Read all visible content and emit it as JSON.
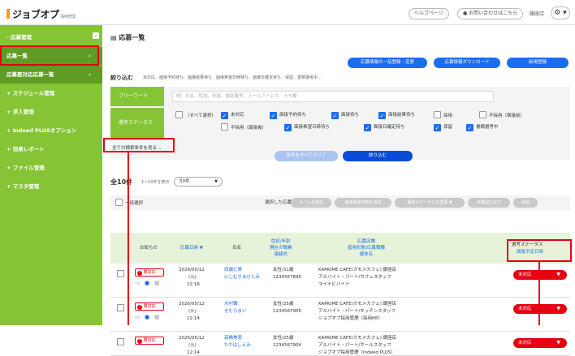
{
  "header": {
    "logo": "ジョブオプ",
    "logo_sub": "採用管理",
    "help": "ヘルプページ",
    "contact": "お問い合わせはこちら",
    "shop": "銀座店",
    "gear": "⚙ ▾"
  },
  "sidebar": {
    "items": [
      {
        "label": "応募管理",
        "prefix": "-"
      },
      {
        "label": "応募一覧",
        "prefix": "",
        "arrow": "›"
      },
      {
        "label": "応募要対応応募一覧",
        "prefix": "",
        "arrow": "›"
      },
      {
        "label": "スケジュール管理",
        "prefix": "+"
      },
      {
        "label": "求人管理",
        "prefix": "+"
      },
      {
        "label": "Indeed PLUSオプション",
        "prefix": "+"
      },
      {
        "label": "効果レポート",
        "prefix": "+"
      },
      {
        "label": "ファイル管理",
        "prefix": "+"
      },
      {
        "label": "マスタ管理",
        "prefix": "+"
      }
    ],
    "collapse": "‹"
  },
  "main": {
    "title": "応募一覧",
    "bulk_change": "応募情報の一括登録・変更",
    "download": "応募情報ダウンロード",
    "new_register": "新規登録",
    "filter_title": "絞り込む",
    "filter_desc": "未対応、面接予約待ち、面接結果待ち、面接希望日時待ち、面接日確定待ち、保留、書類選考中…",
    "freeword_label": "フリーワード",
    "freeword_placeholder": "例）氏名、性別、年齢、電話番号、メールアドレス、メモ欄",
    "status_label": "選考ステータス",
    "checks": [
      {
        "label": "すべて選択",
        "on": false
      },
      {
        "label": "未対応",
        "on": true
      },
      {
        "label": "面接予約待ち",
        "on": true
      },
      {
        "label": "面接待ち",
        "on": true
      },
      {
        "label": "面接結果待ち",
        "on": true
      },
      {
        "label": "採用",
        "on": false
      },
      {
        "label": "不採用（面接前）",
        "on": false
      },
      {
        "label": "不採用（面接後）",
        "on": false
      },
      {
        "label": "面接希望日時待ち",
        "on": true
      },
      {
        "label": "面接日確定待ち",
        "on": true
      },
      {
        "label": "保留",
        "on": true
      },
      {
        "label": "書類選考中",
        "on": true
      }
    ],
    "more_conditions": "全ての検索条件を見る",
    "clear": "条件をすべてクリア",
    "search": "絞り込む",
    "count": "全10件",
    "count_sub": "1～10件を表示",
    "per_page": "50件",
    "select_all": "一括選択",
    "selected_label": "選択した応募に",
    "actions": [
      "メールを送信",
      "面接希望日時を送信",
      "選考ステータスを変更 ▼",
      "未確認に戻す",
      "削除"
    ],
    "columns": {
      "notice": "お知らせ",
      "date": "応募日時 ▼",
      "name": "氏名",
      "profile": "性別/年齢\n現在の職業\n連絡先",
      "job": "応募店舗\n雇用形態/応募職種\n媒体名",
      "status": "選考ステータス",
      "status_sub": "面接予定日時"
    },
    "rows": [
      {
        "notice": "要対応",
        "date": "2026/05/12",
        "day": "(火)",
        "time": "12:16",
        "name": "西端仁美",
        "kana": "にしむきまひとみ",
        "gender_age": "女性/31歳",
        "phone": "1234567890",
        "shop": "KAMOME CAFE(カモメカフェ) 銀座店",
        "job": "アルバイト・パート/カフェスタッフ",
        "media": "マイナビバイト",
        "status": "未対応"
      },
      {
        "notice": "要対応",
        "date": "2026/05/12",
        "day": "(火)",
        "time": "12:14",
        "name": "木村舞",
        "kana": "きむらまい",
        "gender_age": "女性/25歳",
        "phone": "1234567905",
        "shop": "KAMOME CAFE(カモメカフェ) 銀座店",
        "job": "アルバイト・パート/キッチンスタッフ",
        "media": "ジョブオプ採用管理（採用HP）",
        "status": "未対応"
      },
      {
        "notice": "要対応",
        "date": "2026/05/12",
        "day": "(火)",
        "time": "12:14",
        "name": "高橋美恵",
        "kana": "たかはしえみ",
        "gender_age": "女性/25歳",
        "phone": "1234567904",
        "shop": "KAMOME CAFE(カモメカフェ) 銀座店",
        "job": "アルバイト・パート/ホールスタッフ",
        "media": "ジョブオプ採用管理（Indeed PLUS）",
        "status": "未対応"
      }
    ]
  }
}
